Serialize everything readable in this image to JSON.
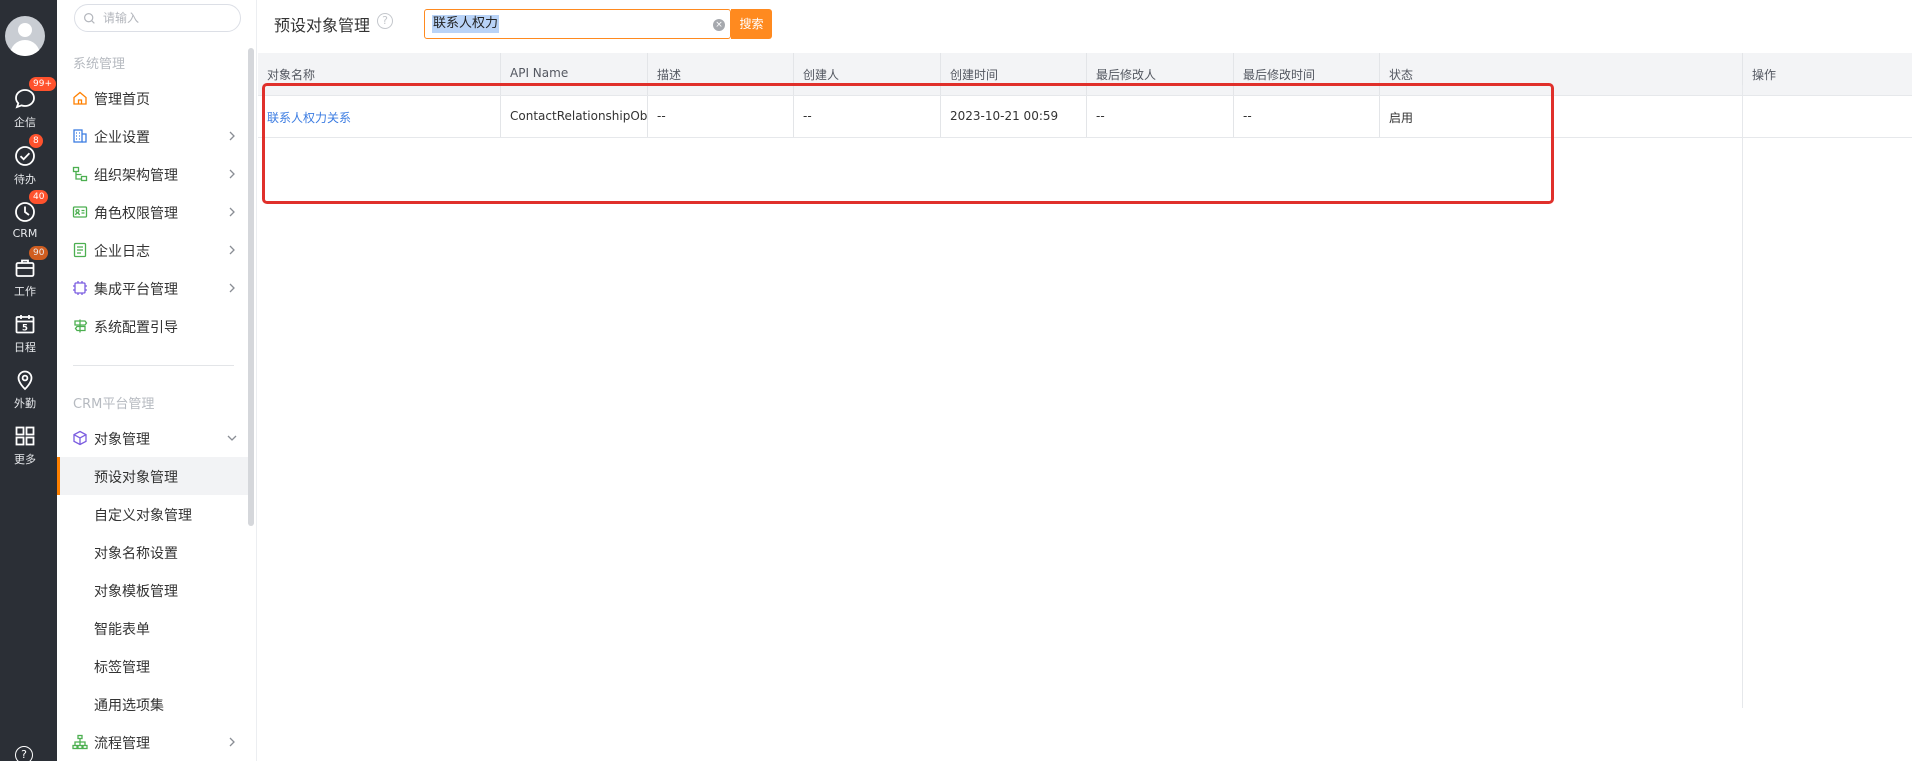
{
  "rail": {
    "items": [
      {
        "label": "企信",
        "badge": "99+"
      },
      {
        "label": "待办",
        "badge": "8"
      },
      {
        "label": "CRM",
        "badge": "40"
      },
      {
        "label": "工作",
        "badge": "90"
      },
      {
        "label": "日程",
        "day": "5"
      },
      {
        "label": "外勤"
      },
      {
        "label": "更多"
      }
    ],
    "help": "?"
  },
  "sidenav": {
    "search_placeholder": "请输入",
    "system_section": "系统管理",
    "system_items": [
      {
        "label": "管理首页",
        "icon": "home-icon",
        "color": "#ff8000"
      },
      {
        "label": "企业设置",
        "icon": "building-icon",
        "color": "#3b7ce2"
      },
      {
        "label": "组织架构管理",
        "icon": "org-icon",
        "color": "#4caf50"
      },
      {
        "label": "角色权限管理",
        "icon": "id-card-icon",
        "color": "#4caf50"
      },
      {
        "label": "企业日志",
        "icon": "log-icon",
        "color": "#4caf50"
      },
      {
        "label": "集成平台管理",
        "icon": "chip-icon",
        "color": "#7b5de0"
      },
      {
        "label": "系统配置引导",
        "icon": "signpost-icon",
        "color": "#4caf50"
      }
    ],
    "crm_section": "CRM平台管理",
    "object_group": {
      "label": "对象管理",
      "icon": "cube-icon",
      "color": "#7b5de0"
    },
    "object_subitems": [
      {
        "label": "预设对象管理",
        "active": true
      },
      {
        "label": "自定义对象管理"
      },
      {
        "label": "对象名称设置"
      },
      {
        "label": "对象模板管理"
      },
      {
        "label": "智能表单"
      },
      {
        "label": "标签管理"
      },
      {
        "label": "通用选项集"
      }
    ],
    "process_item": {
      "label": "流程管理",
      "icon": "flow-icon",
      "color": "#4caf50"
    }
  },
  "main": {
    "title": "预设对象管理",
    "help_icon": "?",
    "search_value": "联系人权力",
    "search_button": "搜索",
    "columns": [
      "对象名称",
      "API Name",
      "描述",
      "创建人",
      "创建时间",
      "最后修改人",
      "最后修改时间",
      "状态",
      "操作"
    ],
    "rows": [
      [
        "联系人权力关系",
        "ContactRelationshipObj",
        "--",
        "--",
        "2023-10-21 00:59",
        "--",
        "--",
        "启用",
        ""
      ]
    ],
    "highlight_color": "#e0302b",
    "accent_color": "#ff8a1f"
  }
}
